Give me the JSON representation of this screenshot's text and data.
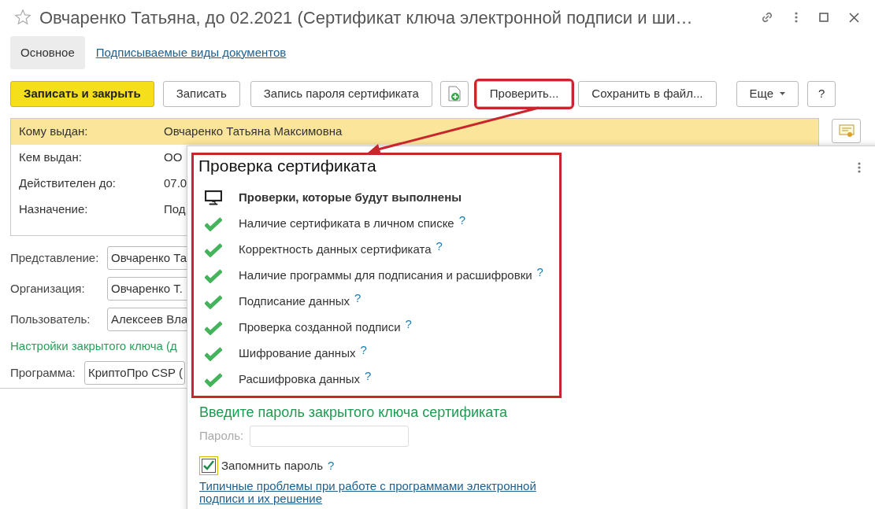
{
  "window": {
    "title": "Овчаренко Татьяна, до 02.2021 (Сертификат ключа электронной подписи и ши…",
    "starred": false
  },
  "tabs": [
    {
      "label": "Основное",
      "selected": true
    },
    {
      "label": "Подписываемые виды документов",
      "selected": false
    }
  ],
  "toolbar": {
    "buttons": [
      {
        "kind": "primary",
        "label": "Записать и закрыть",
        "highlighted": false
      },
      {
        "kind": "plain",
        "label": "Записать",
        "highlighted": false
      },
      {
        "kind": "plain",
        "label": "Запись пароля сертификата",
        "highlighted": false
      },
      {
        "kind": "icon",
        "highlighted": false
      },
      {
        "kind": "plain",
        "label": "Проверить...",
        "highlighted": true
      },
      {
        "kind": "plain",
        "label": "Сохранить в файл...",
        "highlighted": false
      },
      {
        "kind": "menu",
        "label": "Еще",
        "highlighted": false
      },
      {
        "kind": "plain",
        "label": "?",
        "highlighted": false
      }
    ]
  },
  "certificate": {
    "rows": [
      {
        "label": "Кому выдан:",
        "value": "Овчаренко Татьяна Максимовна",
        "selected": true
      },
      {
        "label": "Кем выдан:",
        "value": "ОО",
        "selected": false
      },
      {
        "label": "Действителен до:",
        "value": "07.0",
        "selected": false
      },
      {
        "label": "Назначение:",
        "value": "Под",
        "selected": false
      }
    ]
  },
  "fields": [
    {
      "label": "Представление:",
      "value": "Овчаренко Та"
    },
    {
      "label": "Организация:",
      "value": "Овчаренко Т."
    },
    {
      "label": "Пользователь:",
      "value": "Алексеев Вла"
    }
  ],
  "key_settings_title": "Настройки закрытого ключа (д",
  "program": {
    "label": "Программа:",
    "value": "КриптоПро CSP ("
  },
  "check_popup": {
    "title": "Проверка сертификата",
    "highlighted": true,
    "header": "Проверки, которые будут выполнены",
    "checks": [
      {
        "label": "Наличие сертификата в личном списке",
        "passed": true,
        "help": "?"
      },
      {
        "label": "Корректность данных сертификата",
        "passed": true,
        "help": "?"
      },
      {
        "label": "Наличие программы для подписания и расшифровки",
        "passed": true,
        "help": "?"
      },
      {
        "label": "Подписание данных",
        "passed": true,
        "help": "?"
      },
      {
        "label": "Проверка созданной подписи",
        "passed": true,
        "help": "?"
      },
      {
        "label": "Шифрование данных",
        "passed": true,
        "help": "?"
      },
      {
        "label": "Расшифровка данных",
        "passed": true,
        "help": "?"
      }
    ],
    "password_title": "Введите пароль закрытого ключа сертификата",
    "password": {
      "label": "Пароль:",
      "disabled": true
    },
    "remember": {
      "label": "Запомнить пароль",
      "checked": true,
      "help": "?"
    },
    "link": "Типичные проблемы при работе с программами электронной подписи и их решение"
  }
}
